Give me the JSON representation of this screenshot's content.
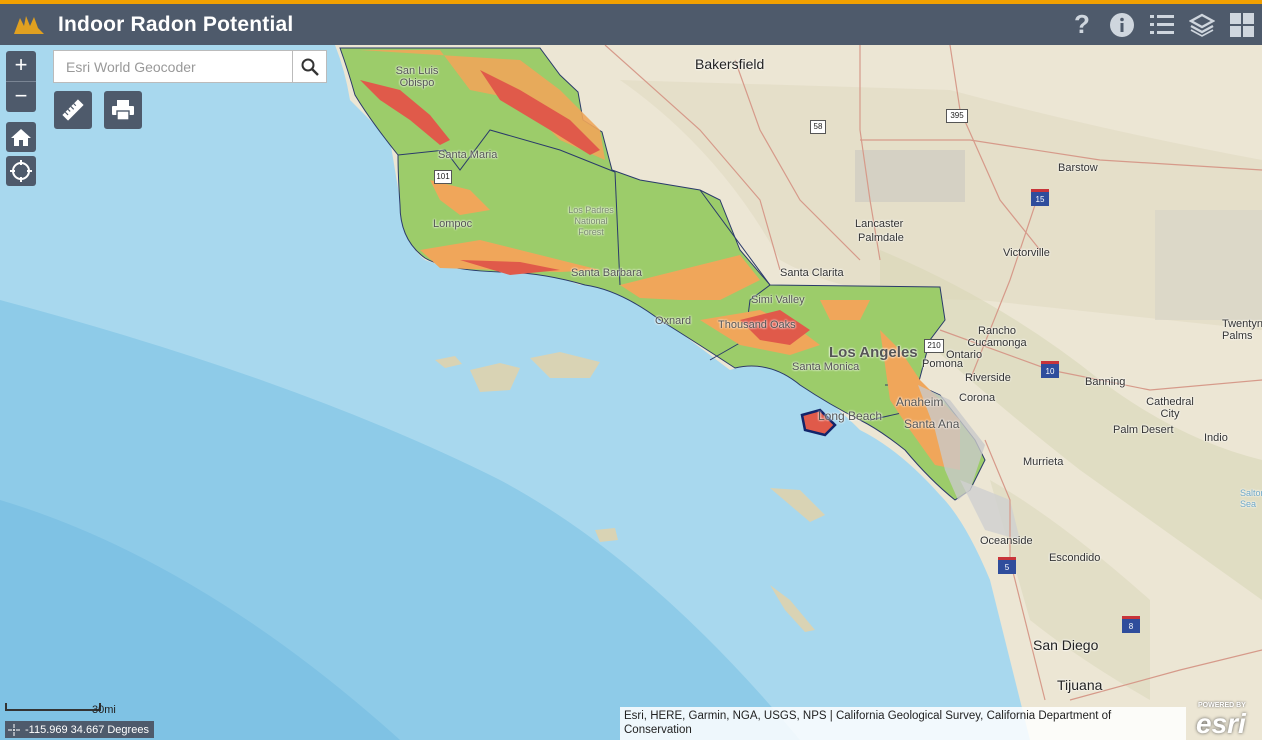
{
  "header": {
    "title": "Indoor Radon Potential",
    "icons": [
      "help-icon",
      "info-icon",
      "legend-icon",
      "layers-icon",
      "grid-icon"
    ]
  },
  "search": {
    "placeholder": "Esri World Geocoder"
  },
  "map": {
    "places": [
      {
        "label": "Bakersfield"
      },
      {
        "label": "San Luis Obispo"
      },
      {
        "label": "Santa Maria"
      },
      {
        "label": "Lompoc"
      },
      {
        "label": "Los Padres National Forest"
      },
      {
        "label": "Santa Barbara"
      },
      {
        "label": "Oxnard"
      },
      {
        "label": "Thousand Oaks"
      },
      {
        "label": "Simi Valley"
      },
      {
        "label": "Santa Clarita"
      },
      {
        "label": "Lancaster"
      },
      {
        "label": "Palmdale"
      },
      {
        "label": "Victorville"
      },
      {
        "label": "Barstow"
      },
      {
        "label": "Los Angeles"
      },
      {
        "label": "Santa Monica"
      },
      {
        "label": "Long Beach"
      },
      {
        "label": "Anaheim"
      },
      {
        "label": "Santa Ana"
      },
      {
        "label": "Rancho Cucamonga"
      },
      {
        "label": "Ontario"
      },
      {
        "label": "Pomona"
      },
      {
        "label": "Riverside"
      },
      {
        "label": "Corona"
      },
      {
        "label": "Banning"
      },
      {
        "label": "Cathedral City"
      },
      {
        "label": "Palm Desert"
      },
      {
        "label": "Indio"
      },
      {
        "label": "Twentynine Palms"
      },
      {
        "label": "Murrieta"
      },
      {
        "label": "Oceanside"
      },
      {
        "label": "Escondido"
      },
      {
        "label": "San Diego"
      },
      {
        "label": "Tijuana"
      },
      {
        "label": "Salton Sea"
      }
    ],
    "shields": [
      "58",
      "395",
      "101",
      "15",
      "210",
      "10",
      "5",
      "8"
    ]
  },
  "scale": {
    "label": "30mi"
  },
  "coordinates": {
    "text": "-115.969 34.667 Degrees"
  },
  "attribution": {
    "text": "Esri, HERE, Garmin, NGA, USGS, NPS | California Geological Survey, California Department of Conservation"
  },
  "esri_logo": {
    "powered": "POWERED BY",
    "brand": "esri"
  }
}
